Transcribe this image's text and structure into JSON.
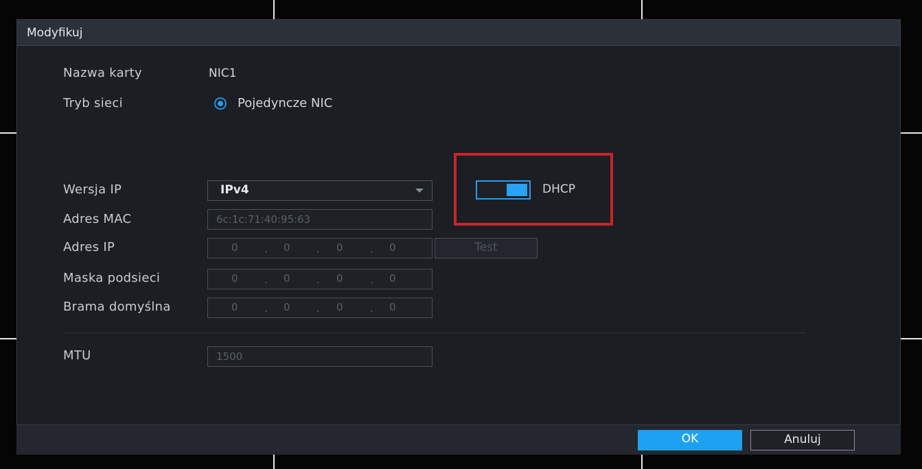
{
  "dialog": {
    "title": "Modyfikuj"
  },
  "form": {
    "card_name_label": "Nazwa karty",
    "card_name_value": "NIC1",
    "net_mode_label": "Tryb sieci",
    "net_mode_option": "Pojedyncze NIC",
    "ip_version_label": "Wersja IP",
    "ip_version_value": "IPv4",
    "dhcp_label": "DHCP",
    "dhcp_enabled": true,
    "mac_label": "Adres MAC",
    "mac_value": "6c:1c:71:40:95:63",
    "ip_label": "Adres IP",
    "ip_value": [
      "0",
      "0",
      "0",
      "0"
    ],
    "test_label": "Test",
    "mask_label": "Maska podsieci",
    "mask_value": [
      "0",
      "0",
      "0",
      "0"
    ],
    "gateway_label": "Brama domyślna",
    "gateway_value": [
      "0",
      "0",
      "0",
      "0"
    ],
    "mtu_label": "MTU",
    "mtu_value": "1500"
  },
  "footer": {
    "ok_label": "OK",
    "cancel_label": "Anuluj"
  },
  "colors": {
    "accent": "#29a3f5",
    "highlight": "#c8242b",
    "background": "#1b1e23"
  }
}
